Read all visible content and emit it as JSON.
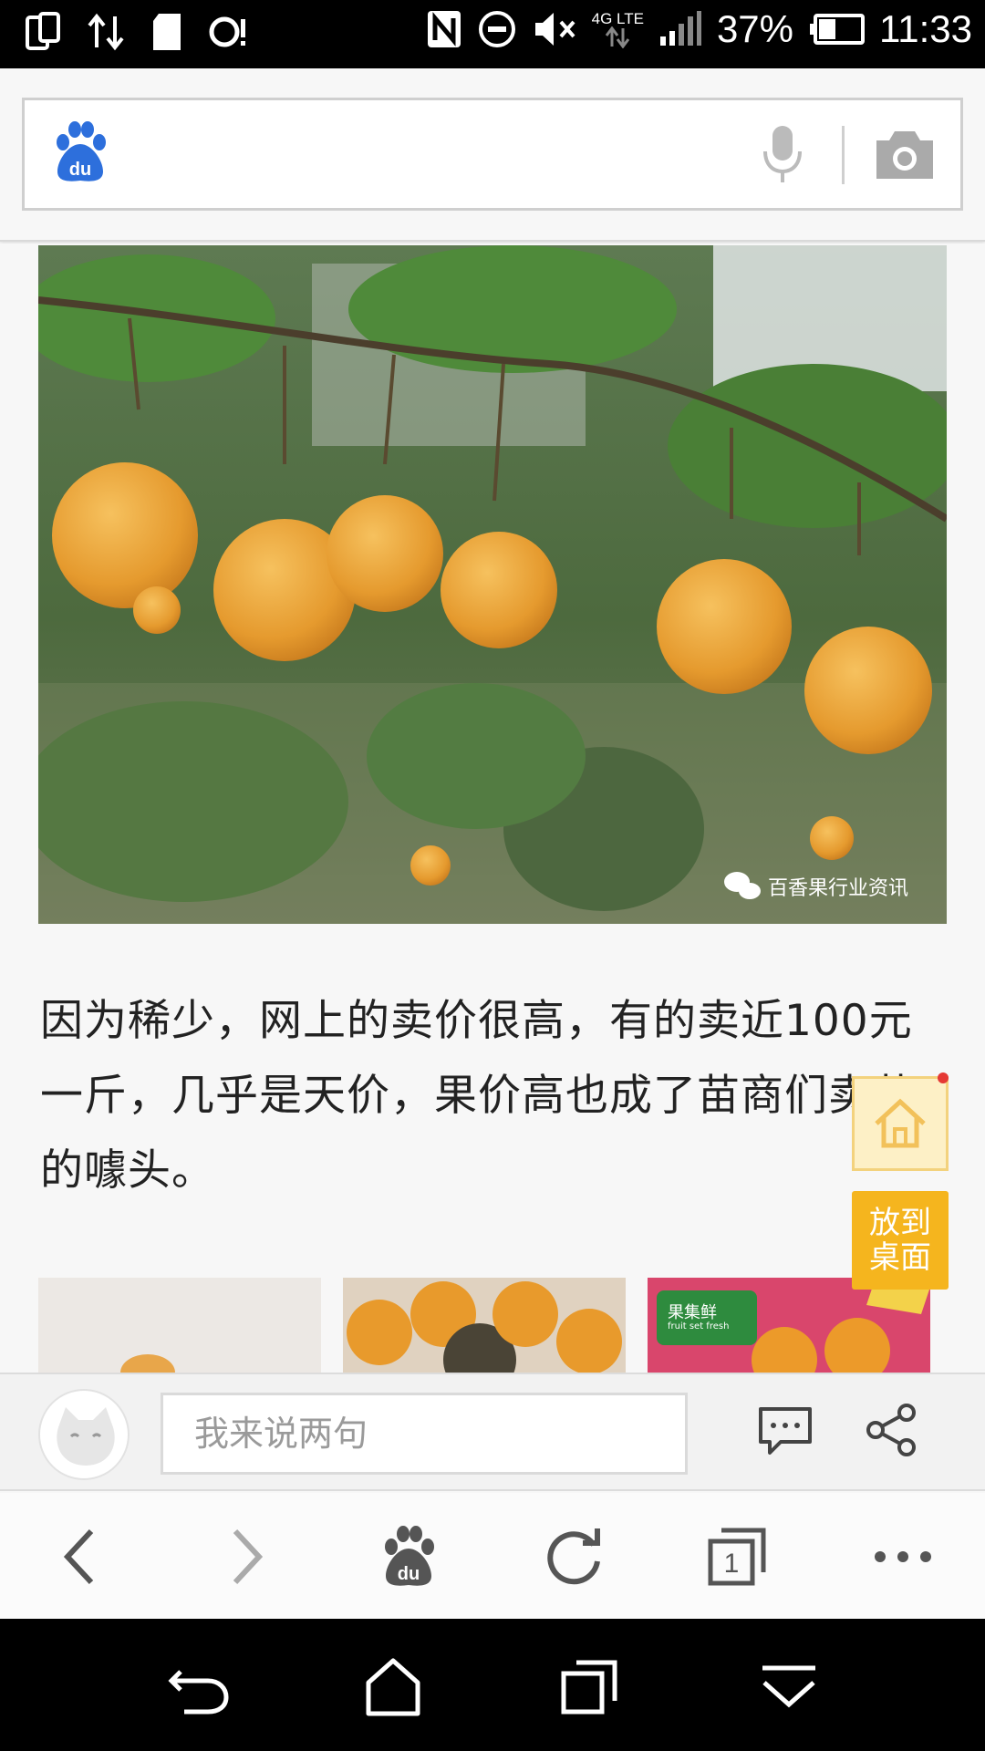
{
  "status_bar": {
    "network": "4G LTE",
    "battery_percent": "37%",
    "time": "11:33"
  },
  "search": {
    "logo_text": "du",
    "placeholder": ""
  },
  "article": {
    "image_watermark": "百香果行业资讯",
    "paragraph": "因为稀少，网上的卖价很高，有的卖近100元一斤，几乎是天价，果价高也成了苗商们卖苗的噱头。"
  },
  "floating": {
    "add_to_desktop": "放到桌面"
  },
  "thumbnails": {
    "thumb3_text": "果集鲜",
    "thumb3_subtext": "fruit set fresh"
  },
  "comment_bar": {
    "placeholder": "我来说两句"
  },
  "toolbar": {
    "tabs_count": "1",
    "baidu_text": "du"
  },
  "colors": {
    "accent_blue": "#2d6fdc",
    "float_yellow": "#f5b51e"
  }
}
